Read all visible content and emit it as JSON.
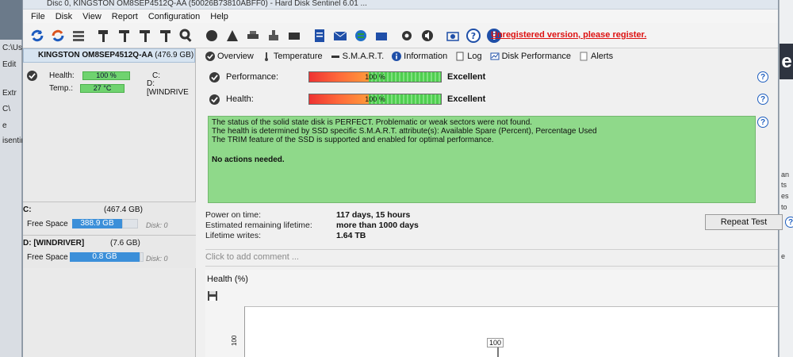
{
  "window": {
    "title": "Disc 0, KINGSTON OM8SEP4512Q-AA (50026B73810ABFF0) - Hard Disk Sentinel 6.01 ..."
  },
  "menu": [
    "File",
    "Disk",
    "View",
    "Report",
    "Configuration",
    "Help"
  ],
  "toolbar": {
    "unregistered_text": "Unregistered version, please register."
  },
  "disk": {
    "name": "KINGSTON OM8SEP4512Q-AA",
    "size": "(476.9 GB)",
    "health_label": "Health:",
    "health_value": "100 %",
    "health_fraction": 1.0,
    "temp_label": "Temp.:",
    "temp_value": "27 °C",
    "partitions_a": "C:",
    "partitions_b": "D: [WINDRIVE"
  },
  "drives": [
    {
      "letter": "C:",
      "size": "(467.4 GB)",
      "free_label": "Free Space",
      "free_value": "388.9 GB",
      "disk_ref": "Disk: 0"
    },
    {
      "letter": "D: [WINDRIVER]",
      "size": "(7.6 GB)",
      "free_label": "Free Space",
      "free_value": "0.8 GB",
      "disk_ref": "Disk: 0"
    }
  ],
  "tabs": [
    "Overview",
    "Temperature",
    "S.M.A.R.T.",
    "Information",
    "Log",
    "Disk Performance",
    "Alerts"
  ],
  "overview": {
    "performance_label": "Performance:",
    "performance_value": "100 %",
    "performance_fraction": 1.0,
    "performance_rating": "Excellent",
    "health_label": "Health:",
    "health_value": "100 %",
    "health_fraction": 1.0,
    "health_rating": "Excellent",
    "status_lines": [
      "The status of the solid state disk is PERFECT. Problematic or weak sectors were not found.",
      "The health is determined by SSD specific S.M.A.R.T. attribute(s):  Available Spare (Percent), Percentage Used",
      "The TRIM feature of the SSD is supported and enabled for optimal performance."
    ],
    "status_action": "No actions needed.",
    "power_on_label": "Power on time:",
    "power_on_value": "117 days, 15 hours",
    "remaining_label": "Estimated remaining lifetime:",
    "remaining_value": "more than 1000 days",
    "writes_label": "Lifetime writes:",
    "writes_value": "1.64 TB",
    "repeat_test": "Repeat Test",
    "comment_placeholder": "Click to add comment ...",
    "chart_title": "Health (%)",
    "chart_axis_tick": "100",
    "chart_point_label": "100"
  },
  "background": {
    "left_texts": [
      "C:\\Use",
      "Edit",
      "Extr",
      "C\\",
      "e",
      "isentir"
    ],
    "right_texts": [
      "e",
      "an",
      "ts",
      "es",
      "to",
      "e"
    ]
  }
}
